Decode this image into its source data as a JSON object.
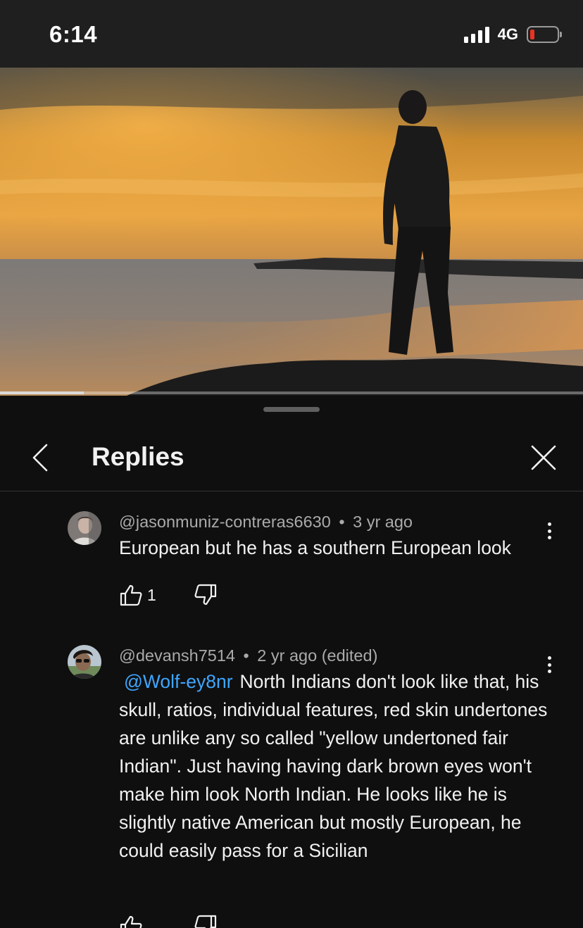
{
  "status_bar": {
    "time": "6:14",
    "network": "4G",
    "battery_color": "#ea3323"
  },
  "video": {
    "progress_percent": 14.4
  },
  "panel": {
    "title": "Replies",
    "back_icon": "chevron-left-icon",
    "close_icon": "close-icon"
  },
  "comments": [
    {
      "author": "@jasonmuniz-contreras6630",
      "separator": "•",
      "time": "3 yr ago",
      "mention": "",
      "text": "European but he has a southern European look",
      "likes": "1"
    },
    {
      "author": "@devansh7514",
      "separator": "•",
      "time": "2 yr ago (edited)",
      "mention": "@Wolf-ey8nr",
      "text": "North Indians don't look like that, his skull, ratios, individual features, red skin undertones are unlike any so called \"yellow undertoned fair Indian\". Just having having dark brown eyes won't make him look North Indian. He looks like he is slightly  native American but mostly European, he could easily pass for a Sicilian",
      "likes": ""
    }
  ],
  "colors": {
    "background": "#0f0f0f",
    "mention": "#3ea6ff",
    "meta_text": "#aaaaaa"
  }
}
